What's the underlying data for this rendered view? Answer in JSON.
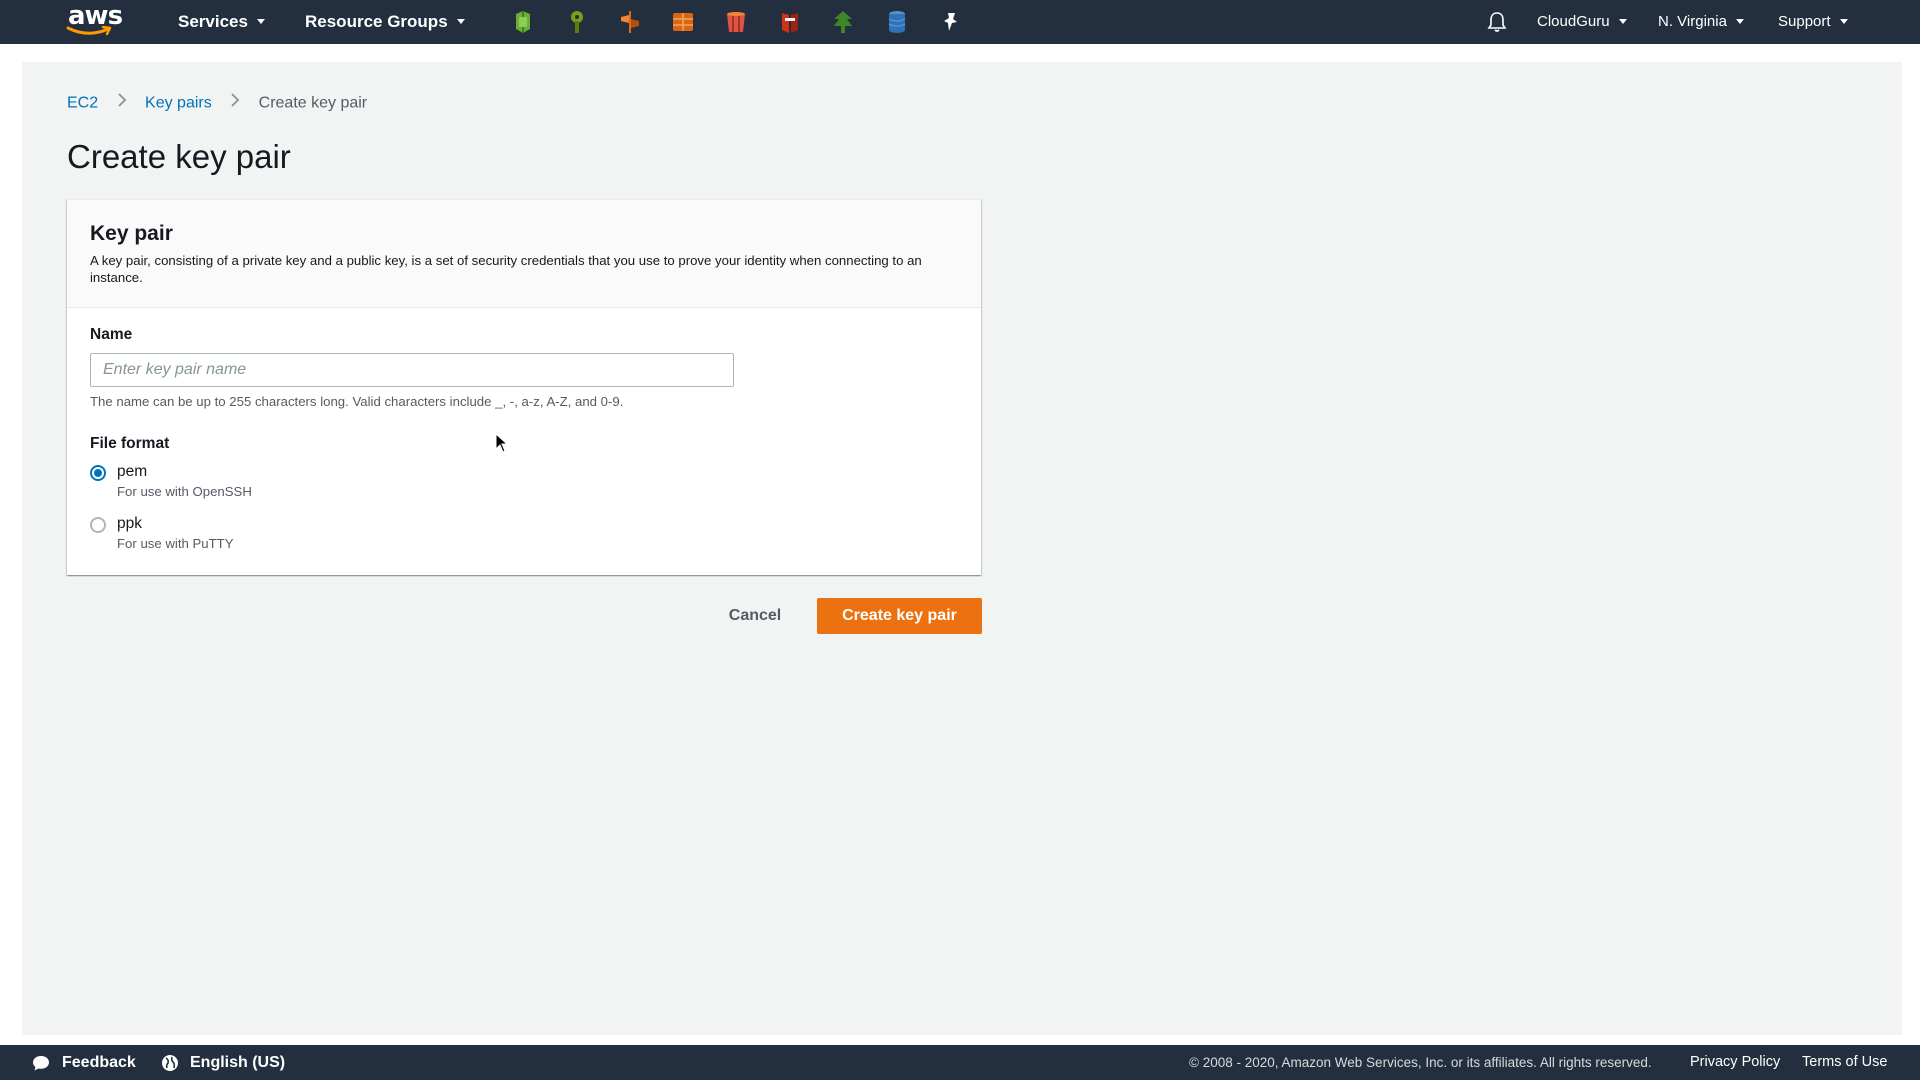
{
  "topnav": {
    "logo_text": "aws",
    "services_label": "Services",
    "resource_groups_label": "Resource Groups",
    "service_shortcuts": [
      {
        "icon": "ec2-icon",
        "color": "#6aaf35"
      },
      {
        "icon": "lambda-icon",
        "color": "#7aa116"
      },
      {
        "icon": "iam-icon",
        "color": "#dd6b10"
      },
      {
        "icon": "cloudformation-icon",
        "color": "#e05243"
      },
      {
        "icon": "s3-icon",
        "color": "#e05243"
      },
      {
        "icon": "cloudtrail-icon",
        "color": "#d13212"
      },
      {
        "icon": "codecommit-icon",
        "color": "#3f8624"
      },
      {
        "icon": "dynamodb-icon",
        "color": "#2e73b8"
      },
      {
        "icon": "pin-icon",
        "color": "#ffffff"
      }
    ],
    "account_label": "CloudGuru",
    "region_label": "N. Virginia",
    "support_label": "Support"
  },
  "breadcrumb": {
    "items": [
      "EC2",
      "Key pairs"
    ],
    "current": "Create key pair"
  },
  "page": {
    "title": "Create key pair"
  },
  "panel": {
    "title": "Key pair",
    "description": "A key pair, consisting of a private key and a public key, is a set of security credentials that you use to prove your identity when connecting to an instance.",
    "name_label": "Name",
    "name_value": "",
    "name_placeholder": "Enter key pair name",
    "name_hint": "The name can be up to 255 characters long. Valid characters include _, -, a-z, A-Z, and 0-9.",
    "file_format_label": "File format",
    "options": [
      {
        "label": "pem",
        "description": "For use with OpenSSH",
        "selected": true
      },
      {
        "label": "ppk",
        "description": "For use with PuTTY",
        "selected": false
      }
    ]
  },
  "actions": {
    "cancel_label": "Cancel",
    "create_label": "Create key pair"
  },
  "footer": {
    "feedback_label": "Feedback",
    "language_label": "English (US)",
    "copyright": "© 2008 - 2020, Amazon Web Services, Inc. or its affiliates. All rights reserved.",
    "privacy_label": "Privacy Policy",
    "terms_label": "Terms of Use"
  },
  "colors": {
    "nav_bg": "#232f3e",
    "primary_button": "#ec7211",
    "link": "#0073bb",
    "page_bg": "#f2f3f3"
  }
}
